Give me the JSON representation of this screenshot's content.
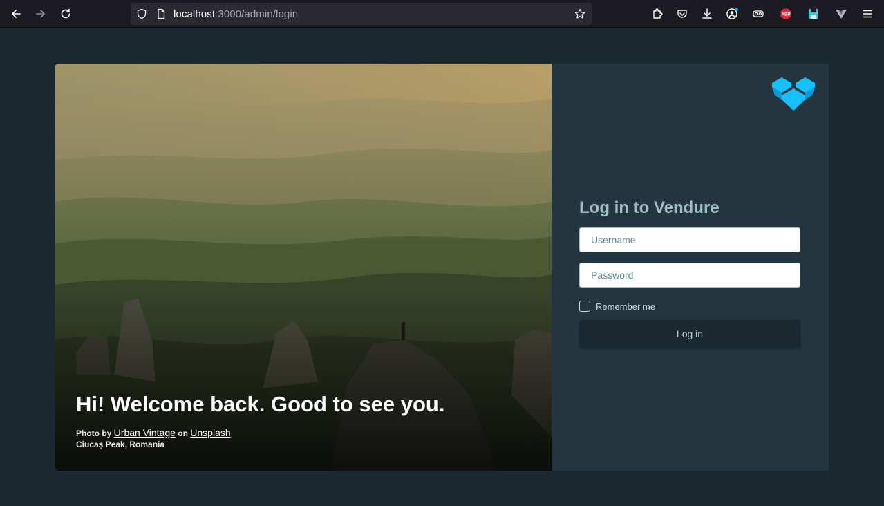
{
  "browser": {
    "url_host": "localhost",
    "url_path": ":3000/admin/login",
    "colors": {
      "toolbar": "#1c1b22",
      "urlbar": "#2b2a33"
    }
  },
  "hero": {
    "title": "Hi! Welcome back. Good to see you.",
    "credit_prefix": "Photo by",
    "photographer": "Urban Vintage",
    "credit_on": "on",
    "source": "Unsplash",
    "location": "Ciucaș Peak, Romania"
  },
  "login": {
    "title": "Log in to Vendure",
    "username_placeholder": "Username",
    "password_placeholder": "Password",
    "remember_label": "Remember me",
    "submit_label": "Log in"
  },
  "colors": {
    "page_bg": "#1b2a31",
    "panel_bg": "#233640",
    "brand": "#17c1ff",
    "title": "#9fbcc8"
  }
}
